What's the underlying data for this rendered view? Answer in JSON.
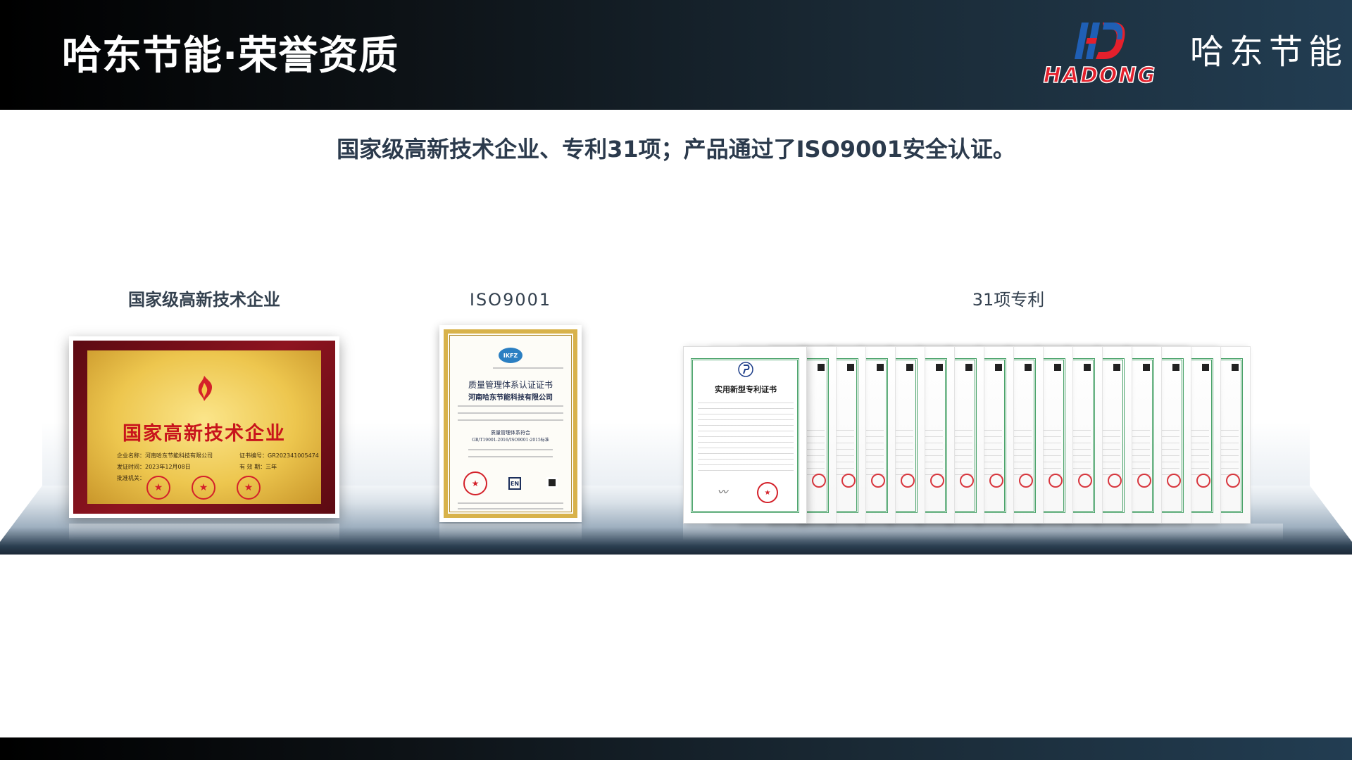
{
  "header": {
    "title": "哈东节能·荣誉资质",
    "logo_text": "HADONG",
    "brand_cn": "哈东节能"
  },
  "subtitle": "国家级高新技术企业、专利31项；产品通过了ISO9001安全认证。",
  "sections": [
    {
      "label": "国家级高新技术企业"
    },
    {
      "label": "ISO9001"
    },
    {
      "label": "31项专利"
    }
  ],
  "plaque": {
    "title": "国家高新技术企业",
    "lines": [
      "企业名称：河南哈东节能科技有限公司",
      "证书编号：GR202341005474",
      "发证时间：2023年12月08日",
      "有 效 期：三年",
      "批准机关："
    ]
  },
  "iso_cert": {
    "badge": "IKFZ",
    "title": "质量管理体系认证证书",
    "company": "河南哈东节能科技有限公司",
    "standard_title": "质量管理体系符合",
    "standard": "GB/T19001-2016/ISO9001:2015标准",
    "cnas": "EN"
  },
  "patent": {
    "title": "实用新型专利证书",
    "count_back": 15
  },
  "colors": {
    "header_dark": "#000000",
    "header_blue": "#223d52",
    "title_text": "#ffffff",
    "accent_red": "#e4202c",
    "subtitle_text": "#2b3a4c"
  },
  "icons": [
    "hadong-logo-icon",
    "torch-emblem-icon",
    "seal-icon",
    "qr-code-icon"
  ]
}
